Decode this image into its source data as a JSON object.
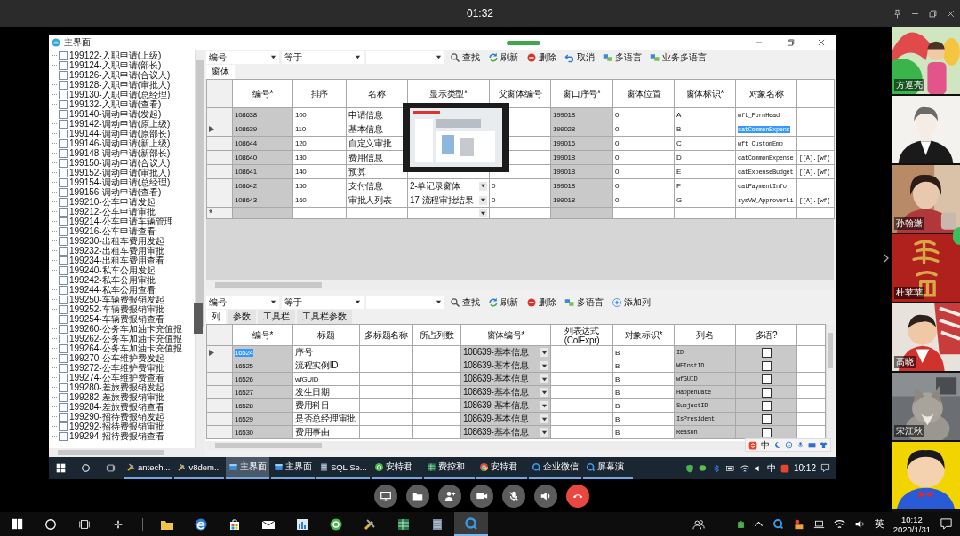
{
  "call": {
    "duration": "01:32"
  },
  "app": {
    "title": "主界面",
    "tree": {
      "items": [
        {
          "label": "199122-入职申请(上级)",
          "checked": false
        },
        {
          "label": "199124-入职申请(部长)",
          "checked": false
        },
        {
          "label": "199126-入职申请(合议人)",
          "checked": false
        },
        {
          "label": "199128-入职申请(审批人)",
          "checked": false
        },
        {
          "label": "199130-入职申请(总经理)",
          "checked": false
        },
        {
          "label": "199132-入职申请(查看)",
          "checked": false
        },
        {
          "label": "199140-调动申请(发起)",
          "checked": false
        },
        {
          "label": "199142-调动申请(原上级)",
          "checked": false
        },
        {
          "label": "199144-调动申请(原部长)",
          "checked": false
        },
        {
          "label": "199146-调动申请(新上级)",
          "checked": false
        },
        {
          "label": "199148-调动申请(新部长)",
          "checked": false
        },
        {
          "label": "199150-调动申请(合议人)",
          "checked": false
        },
        {
          "label": "199152-调动申请(审批人)",
          "checked": false
        },
        {
          "label": "199154-调动申请(总经理)",
          "checked": false
        },
        {
          "label": "199156-调动申请(查看)",
          "checked": false
        },
        {
          "label": "199210-公车申请发起",
          "checked": false
        },
        {
          "label": "199212-公车申请审批",
          "checked": false
        },
        {
          "label": "199214-公车申请车辆管理",
          "checked": false
        },
        {
          "label": "199216-公车申请查看",
          "checked": false
        },
        {
          "label": "199230-出租车费用发起",
          "checked": false
        },
        {
          "label": "199232-出租车费用审批",
          "checked": false
        },
        {
          "label": "199234-出租车费用查看",
          "checked": false
        },
        {
          "label": "199240-私车公用发起",
          "checked": false
        },
        {
          "label": "199242-私车公用审批",
          "checked": false
        },
        {
          "label": "199244-私车公用查看",
          "checked": false
        },
        {
          "label": "199250-车辆费报销发起",
          "checked": false
        },
        {
          "label": "199252-车辆费报销审批",
          "checked": false
        },
        {
          "label": "199254-车辆费报销查看",
          "checked": false
        },
        {
          "label": "199260-公务车加油卡充值报",
          "checked": false
        },
        {
          "label": "199262-公务车加油卡充值报",
          "checked": false
        },
        {
          "label": "199264-公务车加油卡充值报",
          "checked": false
        },
        {
          "label": "199270-公车维护费发起",
          "checked": false
        },
        {
          "label": "199272-公车维护费审批",
          "checked": false
        },
        {
          "label": "199274-公车维护费查看",
          "checked": false
        },
        {
          "label": "199280-差旅费报销发起",
          "checked": false
        },
        {
          "label": "199282-差旅费报销审批",
          "checked": false
        },
        {
          "label": "199284-差旅费报销查看",
          "checked": false
        },
        {
          "label": "199290-招待费报销发起",
          "checked": false
        },
        {
          "label": "199292-招待费报销审批",
          "checked": false
        },
        {
          "label": "199294-招待费报销查看",
          "checked": false
        }
      ]
    },
    "form_toolbar": {
      "filters": [
        "编号",
        "等于"
      ],
      "buttons": [
        {
          "label": "查找",
          "kind": "search"
        },
        {
          "label": "刷新",
          "kind": "refresh"
        },
        {
          "label": "删除",
          "kind": "delete"
        },
        {
          "label": "取消",
          "kind": "cancel"
        },
        {
          "label": "多语言",
          "kind": "language"
        },
        {
          "label": "业务多语言",
          "kind": "language"
        }
      ]
    },
    "form_tabs": [
      {
        "label": "窗体",
        "selected": true
      }
    ],
    "form_grid": {
      "columns": [
        {
          "label": "编号*",
          "kind": "text",
          "readonly": true
        },
        {
          "label": "排序",
          "kind": "text",
          "readonly": false
        },
        {
          "label": "名称",
          "kind": "text",
          "readonly": false
        },
        {
          "label": "显示类型*",
          "kind": "dropdown",
          "readonly": false
        },
        {
          "label": "父窗体编号",
          "kind": "text",
          "readonly": false
        },
        {
          "label": "窗口序号*",
          "kind": "text",
          "readonly": true
        },
        {
          "label": "窗体位置",
          "kind": "text",
          "readonly": false
        },
        {
          "label": "窗体标识*",
          "kind": "text",
          "readonly": false
        },
        {
          "label": "对象名称",
          "kind": "code",
          "readonly": false
        },
        {
          "kind": "code",
          "readonly": false
        }
      ],
      "rows": [
        {
          "current": false,
          "cells": [
            "108638",
            "100",
            "申请信息",
            null,
            null,
            "199018",
            "0",
            "A",
            "wft_FormHead",
            null
          ]
        },
        {
          "current": true,
          "cells": [
            "108639",
            "110",
            "基本信息",
            null,
            null,
            "199028",
            "0",
            "B",
            {
              "text": "catCommonExpens",
              "selected": true
            },
            null
          ]
        },
        {
          "current": false,
          "cells": [
            "108644",
            "120",
            "自定义审批",
            null,
            null,
            "199016",
            "0",
            "C",
            "wft_CustomEmp",
            null
          ]
        },
        {
          "current": false,
          "cells": [
            "108640",
            "130",
            "费用信息",
            null,
            null,
            "199018",
            "0",
            "D",
            "catCommonExpense",
            "[[A].[wf("
          ]
        },
        {
          "current": false,
          "cells": [
            "108641",
            "140",
            "预算",
            null,
            null,
            "199018",
            "0",
            "E",
            "catExpenseBudget",
            "[[A].[wf("
          ]
        },
        {
          "current": false,
          "cells": [
            "108642",
            "150",
            "支付信息",
            "2-单记录窗体",
            "0",
            "199018",
            "0",
            "F",
            "catPaymentInfo",
            null
          ]
        },
        {
          "current": false,
          "cells": [
            "108643",
            "160",
            "审批人列表",
            "17-流程审批结果",
            "0",
            "199018",
            "0",
            "G",
            "sysVW_ApproverLi",
            "[[A].[wf("
          ]
        }
      ],
      "new_row_mark": "*"
    },
    "column_toolbar": {
      "filters": [
        "编号",
        "等于"
      ],
      "buttons": [
        {
          "label": "查找",
          "kind": "search"
        },
        {
          "label": "刷新",
          "kind": "refresh"
        },
        {
          "label": "删除",
          "kind": "delete"
        },
        {
          "label": "多语言",
          "kind": "language"
        },
        {
          "label": "添加列",
          "kind": "add"
        }
      ]
    },
    "column_tabs": [
      {
        "label": "列",
        "selected": true
      },
      {
        "label": "参数",
        "selected": false
      },
      {
        "label": "工具栏",
        "selected": false
      },
      {
        "label": "工具栏参数",
        "selected": false
      }
    ],
    "column_grid": {
      "columns": [
        {
          "label": "编号*",
          "kind": "text",
          "readonly": true
        },
        {
          "label": "标题",
          "kind": "text",
          "readonly": false
        },
        {
          "label": "多标题名称",
          "kind": "text",
          "readonly": false
        },
        {
          "label": "所占列数",
          "kind": "text",
          "readonly": false
        },
        {
          "label": "窗体编号*",
          "kind": "dropdown",
          "readonly": true
        },
        {
          "label": "列表达式(ColExpr)",
          "kind": "text",
          "readonly": false
        },
        {
          "label": "对象标识*",
          "kind": "text",
          "readonly": false
        },
        {
          "label": "列名",
          "kind": "code",
          "readonly": true
        },
        {
          "label": "多语?",
          "kind": "checkbox",
          "readonly": true
        },
        {
          "kind": "text",
          "readonly": false
        }
      ],
      "rows": [
        {
          "current": true,
          "cells": [
            {
              "text": "16524",
              "selected": true
            },
            "序号",
            null,
            null,
            "108639-基本信息",
            null,
            "B",
            "ID",
            false,
            null
          ]
        },
        {
          "current": false,
          "cells": [
            "16525",
            "流程实例ID",
            null,
            null,
            "108639-基本信息",
            null,
            "B",
            "WFInstID",
            false,
            null
          ]
        },
        {
          "current": false,
          "cells": [
            "16526",
            "wfGUID",
            null,
            null,
            "108639-基本信息",
            null,
            "B",
            "wfGUID",
            false,
            null
          ]
        },
        {
          "current": false,
          "cells": [
            "16527",
            "发生日期",
            null,
            null,
            "108639-基本信息",
            null,
            "B",
            "HappenDate",
            false,
            null
          ]
        },
        {
          "current": false,
          "cells": [
            "16528",
            "费用科目",
            null,
            null,
            "108639-基本信息",
            null,
            "B",
            "SubjectID",
            false,
            null
          ]
        },
        {
          "current": false,
          "cells": [
            "16529",
            "是否总经理审批",
            null,
            null,
            "108639-基本信息",
            null,
            "B",
            "IsPresident",
            false,
            null
          ]
        },
        {
          "current": false,
          "cells": [
            "16530",
            "费用事由",
            null,
            null,
            "108639-基本信息",
            null,
            "B",
            "Reason",
            false,
            null
          ]
        }
      ]
    },
    "ime_bar": {
      "mode": "中"
    }
  },
  "screen_taskbar": {
    "apps": [
      {
        "label": "antech...",
        "kind": "tools",
        "active": false
      },
      {
        "label": "v8dem...",
        "kind": "tools",
        "active": false
      },
      {
        "label": "主界面",
        "kind": "window",
        "active": true
      },
      {
        "label": "主界面",
        "kind": "window",
        "active": false
      },
      {
        "label": "SQL Se...",
        "kind": "server",
        "active": false
      },
      {
        "label": "安特君...",
        "kind": "sync",
        "active": false
      },
      {
        "label": "费控和...",
        "kind": "sheet",
        "active": false
      },
      {
        "label": "安特君...",
        "kind": "browser",
        "active": false
      },
      {
        "label": "企业微信",
        "kind": "ring",
        "active": false
      },
      {
        "label": "屏幕演...",
        "kind": "ring",
        "active": false
      }
    ],
    "tray": {
      "input": "中",
      "time": "10:12"
    }
  },
  "call_controls": [
    {
      "kind": "share-screen"
    },
    {
      "kind": "file"
    },
    {
      "kind": "invite"
    },
    {
      "kind": "camera"
    },
    {
      "kind": "mic"
    },
    {
      "kind": "speaker"
    },
    {
      "kind": "hang-up"
    }
  ],
  "participants": [
    {
      "name": "方逗亮",
      "kind": "picture"
    },
    {
      "kind": "picture"
    },
    {
      "name": "孙翰潇",
      "kind": "picture"
    },
    {
      "name": "杜苹苹",
      "kind": "picture"
    },
    {
      "name": "高晓",
      "kind": "picture"
    },
    {
      "name": "宋江秋",
      "kind": "picture"
    },
    {
      "kind": "picture"
    }
  ],
  "taskbar": {
    "apps": [
      {
        "kind": "pinwheel",
        "active": false
      },
      {
        "kind": "folder",
        "active": false
      },
      {
        "kind": "swirl",
        "active": false
      },
      {
        "kind": "bag",
        "active": false
      },
      {
        "kind": "mail",
        "active": false
      },
      {
        "kind": "chart",
        "active": false
      },
      {
        "kind": "sync",
        "active": false
      },
      {
        "kind": "tools",
        "active": false
      },
      {
        "kind": "sheet",
        "active": false
      },
      {
        "kind": "server",
        "active": false
      },
      {
        "kind": "ring",
        "active": true
      }
    ],
    "tray": {
      "input": "英",
      "time": "10:12",
      "date": "2020/1/31"
    }
  }
}
